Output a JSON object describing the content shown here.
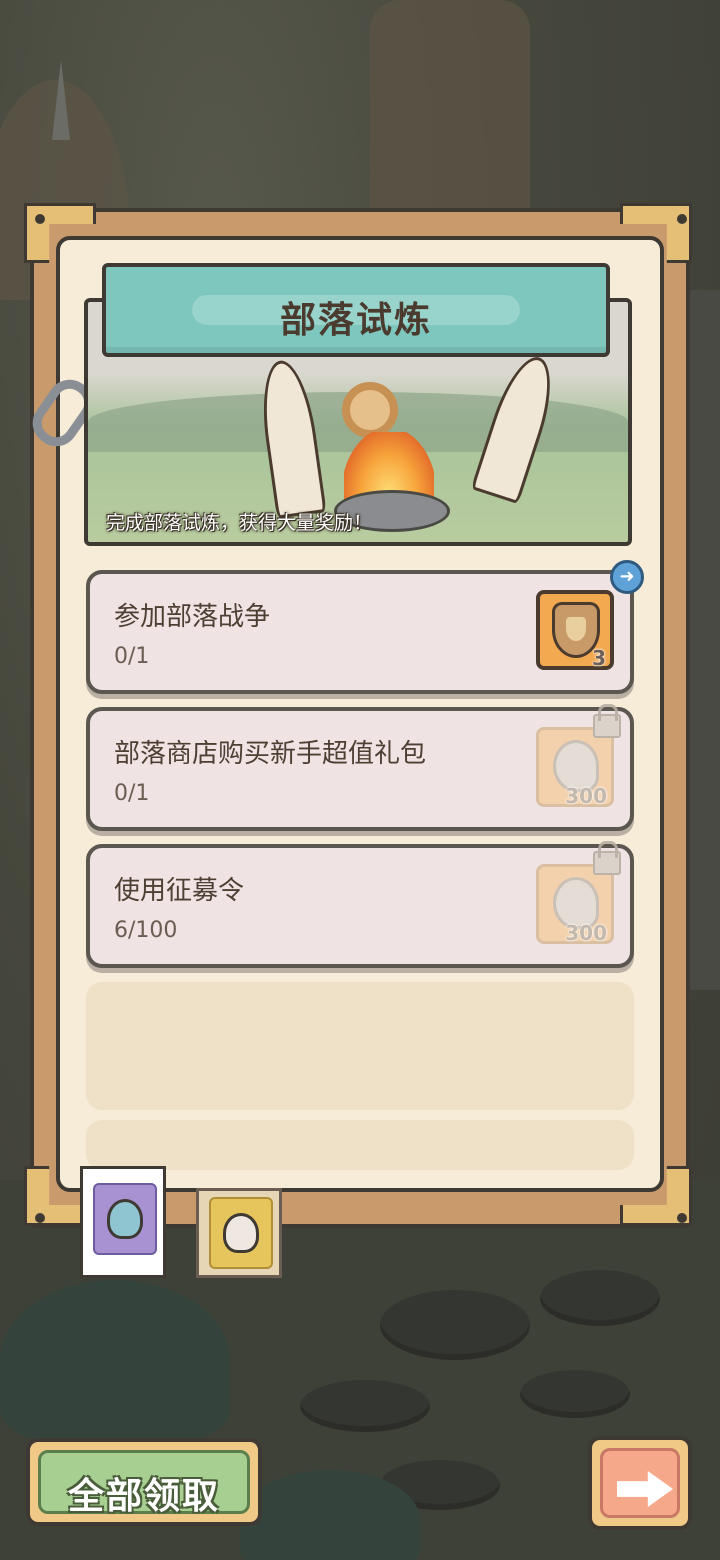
{
  "panel": {
    "title": "部落试炼",
    "banner_caption": "完成部落试炼，获得大量奖励！"
  },
  "quests": [
    {
      "name": "参加部落战争",
      "progress": "0/1",
      "reward_count": "3",
      "reward_icon": "shield-icon",
      "locked": false
    },
    {
      "name": "部落商店购买新手超值礼包",
      "progress": "0/1",
      "reward_count": "300",
      "reward_icon": "ghost-icon",
      "locked": true
    },
    {
      "name": "使用征募令",
      "progress": "6/100",
      "reward_count": "300",
      "reward_icon": "ghost-icon",
      "locked": true
    }
  ],
  "tabs": [
    {
      "icon": "blue-skull-icon",
      "active": true
    },
    {
      "icon": "white-skull-icon",
      "active": false
    }
  ],
  "buttons": {
    "claim_all": "全部领取",
    "next_icon": "arrow-right-icon"
  },
  "colors": {
    "title_bar": "#7ec7be",
    "claim_button": "#a8cf92",
    "next_button": "#f6a98a",
    "reward_active": "#f2a950"
  }
}
